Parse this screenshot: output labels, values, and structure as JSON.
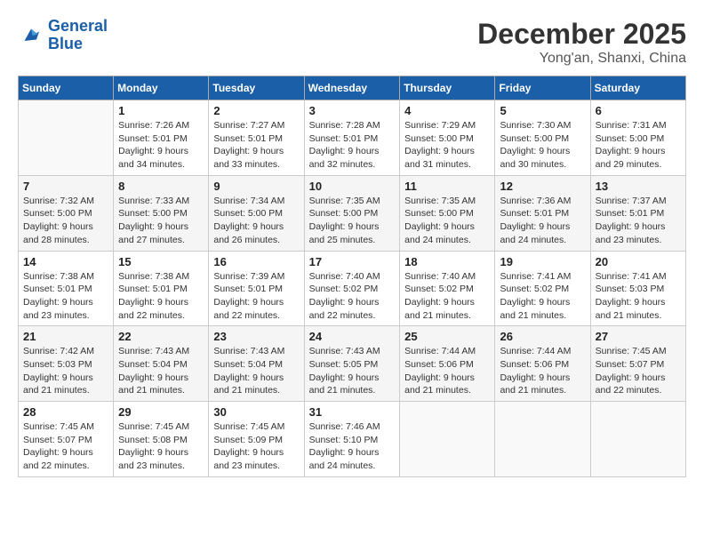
{
  "header": {
    "logo_line1": "General",
    "logo_line2": "Blue",
    "month_title": "December 2025",
    "location": "Yong'an, Shanxi, China"
  },
  "weekdays": [
    "Sunday",
    "Monday",
    "Tuesday",
    "Wednesday",
    "Thursday",
    "Friday",
    "Saturday"
  ],
  "weeks": [
    [
      {
        "day": "",
        "info": ""
      },
      {
        "day": "1",
        "info": "Sunrise: 7:26 AM\nSunset: 5:01 PM\nDaylight: 9 hours\nand 34 minutes."
      },
      {
        "day": "2",
        "info": "Sunrise: 7:27 AM\nSunset: 5:01 PM\nDaylight: 9 hours\nand 33 minutes."
      },
      {
        "day": "3",
        "info": "Sunrise: 7:28 AM\nSunset: 5:01 PM\nDaylight: 9 hours\nand 32 minutes."
      },
      {
        "day": "4",
        "info": "Sunrise: 7:29 AM\nSunset: 5:00 PM\nDaylight: 9 hours\nand 31 minutes."
      },
      {
        "day": "5",
        "info": "Sunrise: 7:30 AM\nSunset: 5:00 PM\nDaylight: 9 hours\nand 30 minutes."
      },
      {
        "day": "6",
        "info": "Sunrise: 7:31 AM\nSunset: 5:00 PM\nDaylight: 9 hours\nand 29 minutes."
      }
    ],
    [
      {
        "day": "7",
        "info": "Sunrise: 7:32 AM\nSunset: 5:00 PM\nDaylight: 9 hours\nand 28 minutes."
      },
      {
        "day": "8",
        "info": "Sunrise: 7:33 AM\nSunset: 5:00 PM\nDaylight: 9 hours\nand 27 minutes."
      },
      {
        "day": "9",
        "info": "Sunrise: 7:34 AM\nSunset: 5:00 PM\nDaylight: 9 hours\nand 26 minutes."
      },
      {
        "day": "10",
        "info": "Sunrise: 7:35 AM\nSunset: 5:00 PM\nDaylight: 9 hours\nand 25 minutes."
      },
      {
        "day": "11",
        "info": "Sunrise: 7:35 AM\nSunset: 5:00 PM\nDaylight: 9 hours\nand 24 minutes."
      },
      {
        "day": "12",
        "info": "Sunrise: 7:36 AM\nSunset: 5:01 PM\nDaylight: 9 hours\nand 24 minutes."
      },
      {
        "day": "13",
        "info": "Sunrise: 7:37 AM\nSunset: 5:01 PM\nDaylight: 9 hours\nand 23 minutes."
      }
    ],
    [
      {
        "day": "14",
        "info": "Sunrise: 7:38 AM\nSunset: 5:01 PM\nDaylight: 9 hours\nand 23 minutes."
      },
      {
        "day": "15",
        "info": "Sunrise: 7:38 AM\nSunset: 5:01 PM\nDaylight: 9 hours\nand 22 minutes."
      },
      {
        "day": "16",
        "info": "Sunrise: 7:39 AM\nSunset: 5:01 PM\nDaylight: 9 hours\nand 22 minutes."
      },
      {
        "day": "17",
        "info": "Sunrise: 7:40 AM\nSunset: 5:02 PM\nDaylight: 9 hours\nand 22 minutes."
      },
      {
        "day": "18",
        "info": "Sunrise: 7:40 AM\nSunset: 5:02 PM\nDaylight: 9 hours\nand 21 minutes."
      },
      {
        "day": "19",
        "info": "Sunrise: 7:41 AM\nSunset: 5:02 PM\nDaylight: 9 hours\nand 21 minutes."
      },
      {
        "day": "20",
        "info": "Sunrise: 7:41 AM\nSunset: 5:03 PM\nDaylight: 9 hours\nand 21 minutes."
      }
    ],
    [
      {
        "day": "21",
        "info": "Sunrise: 7:42 AM\nSunset: 5:03 PM\nDaylight: 9 hours\nand 21 minutes."
      },
      {
        "day": "22",
        "info": "Sunrise: 7:43 AM\nSunset: 5:04 PM\nDaylight: 9 hours\nand 21 minutes."
      },
      {
        "day": "23",
        "info": "Sunrise: 7:43 AM\nSunset: 5:04 PM\nDaylight: 9 hours\nand 21 minutes."
      },
      {
        "day": "24",
        "info": "Sunrise: 7:43 AM\nSunset: 5:05 PM\nDaylight: 9 hours\nand 21 minutes."
      },
      {
        "day": "25",
        "info": "Sunrise: 7:44 AM\nSunset: 5:06 PM\nDaylight: 9 hours\nand 21 minutes."
      },
      {
        "day": "26",
        "info": "Sunrise: 7:44 AM\nSunset: 5:06 PM\nDaylight: 9 hours\nand 21 minutes."
      },
      {
        "day": "27",
        "info": "Sunrise: 7:45 AM\nSunset: 5:07 PM\nDaylight: 9 hours\nand 22 minutes."
      }
    ],
    [
      {
        "day": "28",
        "info": "Sunrise: 7:45 AM\nSunset: 5:07 PM\nDaylight: 9 hours\nand 22 minutes."
      },
      {
        "day": "29",
        "info": "Sunrise: 7:45 AM\nSunset: 5:08 PM\nDaylight: 9 hours\nand 23 minutes."
      },
      {
        "day": "30",
        "info": "Sunrise: 7:45 AM\nSunset: 5:09 PM\nDaylight: 9 hours\nand 23 minutes."
      },
      {
        "day": "31",
        "info": "Sunrise: 7:46 AM\nSunset: 5:10 PM\nDaylight: 9 hours\nand 24 minutes."
      },
      {
        "day": "",
        "info": ""
      },
      {
        "day": "",
        "info": ""
      },
      {
        "day": "",
        "info": ""
      }
    ]
  ]
}
